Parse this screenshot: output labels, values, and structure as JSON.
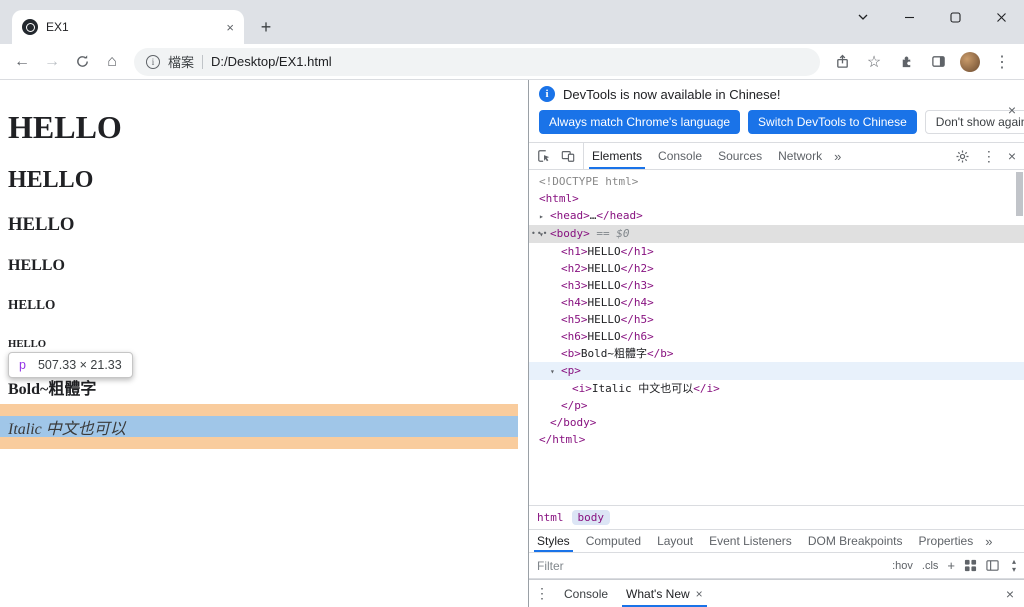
{
  "colors": {
    "accent": "#1A73E8"
  },
  "browser": {
    "tab": {
      "title": "EX1",
      "close": "×"
    },
    "new_tab_button": "+",
    "nav": {
      "back": "←",
      "forward": "→",
      "home": "⌂"
    },
    "address": {
      "scheme_label": "檔案",
      "url": "D:/Desktop/EX1.html"
    },
    "menu_dots": "⋮"
  },
  "page": {
    "headings": [
      "HELLO",
      "HELLO",
      "HELLO",
      "HELLO",
      "HELLO",
      "HELLO"
    ],
    "bold_text": "Bold~粗體字",
    "italic_text": "Italic 中文也可以",
    "tooltip": {
      "tag": "p",
      "size": "507.33 × 21.33"
    },
    "highlight": {
      "content_color": "rgba(111,168,220,0.66)",
      "margin_color": "rgba(246,178,107,0.66)"
    }
  },
  "devtools": {
    "banner": {
      "message": "DevTools is now available in Chinese!",
      "primary_buttons": [
        "Always match Chrome's language",
        "Switch DevTools to Chinese"
      ],
      "secondary_button": "Don't show again",
      "close": "×"
    },
    "tabs": [
      "Elements",
      "Console",
      "Sources",
      "Network"
    ],
    "overflow": "»",
    "menu_dots": "⋮",
    "close": "×",
    "tree": [
      {
        "level": 0,
        "segs": [
          [
            "d",
            "<!DOCTYPE html>"
          ]
        ]
      },
      {
        "level": 0,
        "segs": [
          [
            "t",
            "<html>"
          ]
        ]
      },
      {
        "level": 1,
        "arrow": "▸",
        "segs": [
          [
            "t",
            "<head>"
          ],
          [
            "x",
            "…"
          ],
          [
            "t",
            "</head>"
          ]
        ]
      },
      {
        "level": 1,
        "arrow": "▾",
        "state": "selected",
        "gutter": "•••",
        "segs": [
          [
            "t",
            "<body>"
          ],
          [
            "m",
            " == $0"
          ]
        ]
      },
      {
        "level": 2,
        "segs": [
          [
            "t",
            "<h1>"
          ],
          [
            "x",
            "HELLO"
          ],
          [
            "t",
            "</h1>"
          ]
        ]
      },
      {
        "level": 2,
        "segs": [
          [
            "t",
            "<h2>"
          ],
          [
            "x",
            "HELLO"
          ],
          [
            "t",
            "</h2>"
          ]
        ]
      },
      {
        "level": 2,
        "segs": [
          [
            "t",
            "<h3>"
          ],
          [
            "x",
            "HELLO"
          ],
          [
            "t",
            "</h3>"
          ]
        ]
      },
      {
        "level": 2,
        "segs": [
          [
            "t",
            "<h4>"
          ],
          [
            "x",
            "HELLO"
          ],
          [
            "t",
            "</h4>"
          ]
        ]
      },
      {
        "level": 2,
        "segs": [
          [
            "t",
            "<h5>"
          ],
          [
            "x",
            "HELLO"
          ],
          [
            "t",
            "</h5>"
          ]
        ]
      },
      {
        "level": 2,
        "segs": [
          [
            "t",
            "<h6>"
          ],
          [
            "x",
            "HELLO"
          ],
          [
            "t",
            "</h6>"
          ]
        ]
      },
      {
        "level": 2,
        "segs": [
          [
            "t",
            "<b>"
          ],
          [
            "x",
            "Bold~粗體字"
          ],
          [
            "t",
            "</b>"
          ]
        ]
      },
      {
        "level": 2,
        "arrow": "▾",
        "state": "hover",
        "segs": [
          [
            "t",
            "<p>"
          ]
        ]
      },
      {
        "level": 3,
        "segs": [
          [
            "t",
            "<i>"
          ],
          [
            "x",
            "Italic 中文也可以"
          ],
          [
            "t",
            "</i>"
          ]
        ]
      },
      {
        "level": 2,
        "segs": [
          [
            "t",
            "</p>"
          ]
        ]
      },
      {
        "level": 1,
        "segs": [
          [
            "t",
            "</body>"
          ]
        ]
      },
      {
        "level": 0,
        "segs": [
          [
            "t",
            "</html>"
          ]
        ]
      }
    ],
    "breadcrumbs": [
      "html",
      "body"
    ],
    "sidebar_tabs": [
      "Styles",
      "Computed",
      "Layout",
      "Event Listeners",
      "DOM Breakpoints",
      "Properties"
    ],
    "filter_placeholder": "Filter",
    "style_toolbar": {
      "hov": ":hov",
      "cls": ".cls",
      "add": "+"
    },
    "drawer": {
      "console": "Console",
      "whats_new": "What's New",
      "tab_close": "×",
      "close": "×"
    }
  }
}
